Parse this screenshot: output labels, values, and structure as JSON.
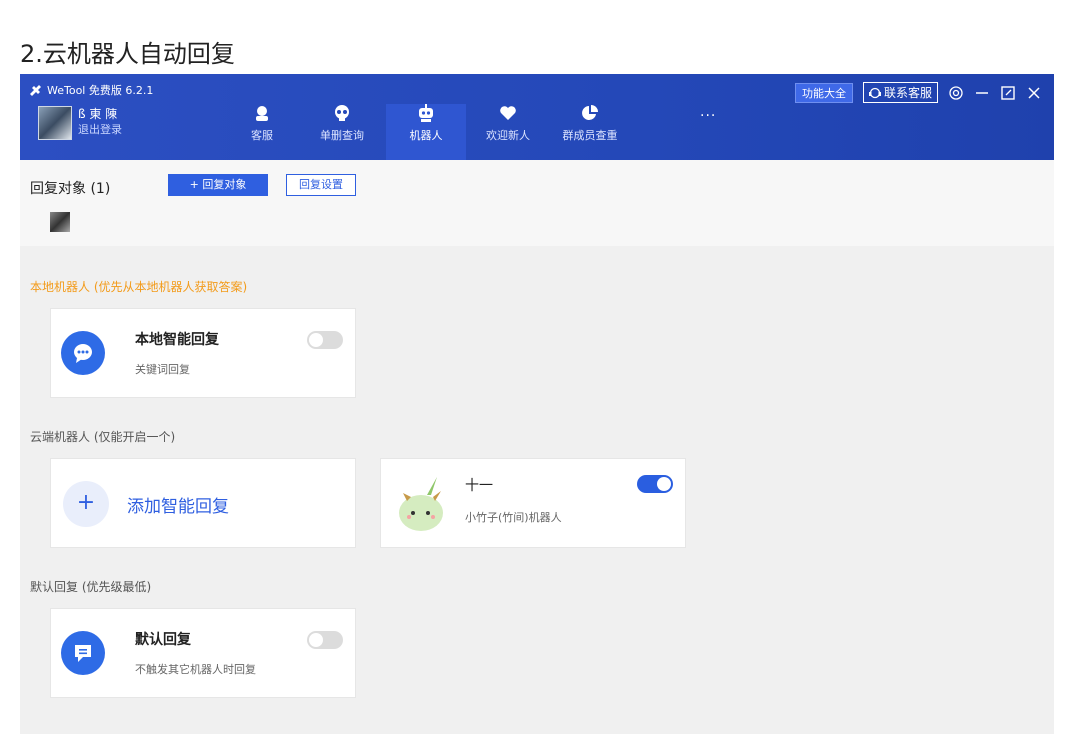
{
  "doc_heading": "2.云机器人自动回复",
  "app": {
    "title": "WeTool 免费版 6.2.1",
    "user": {
      "name": "ß 東 陳",
      "logout": "退出登录"
    },
    "nav": [
      {
        "label": "客服",
        "icon": "headset-icon"
      },
      {
        "label": "单删查询",
        "icon": "skull-icon"
      },
      {
        "label": "机器人",
        "icon": "robot-icon",
        "active": true
      },
      {
        "label": "欢迎新人",
        "icon": "heart-icon"
      },
      {
        "label": "群成员查重",
        "icon": "pie-chart-icon"
      }
    ],
    "more": "···",
    "func_button": "功能大全",
    "contact_button": "联系客服",
    "accent": "#2f5fe0"
  },
  "reply_target": {
    "label": "回复对象 (1)",
    "add_button": "+ 回复对象",
    "settings_button": "回复设置"
  },
  "sections": {
    "local": "本地机器人 (优先从本地机器人获取答案)",
    "cloud": "云端机器人 (仅能开启一个)",
    "default": "默认回复 (优先级最低)"
  },
  "cards": {
    "local_smart": {
      "title": "本地智能回复",
      "subtitle": "关键词回复",
      "enabled": false
    },
    "add_smart": {
      "label": "添加智能回复",
      "plus": "+"
    },
    "bamboo": {
      "title": "十一",
      "subtitle": "小竹子(竹间)机器人",
      "enabled": true
    },
    "default_reply": {
      "title": "默认回复",
      "subtitle": "不触发其它机器人时回复",
      "enabled": false
    }
  }
}
